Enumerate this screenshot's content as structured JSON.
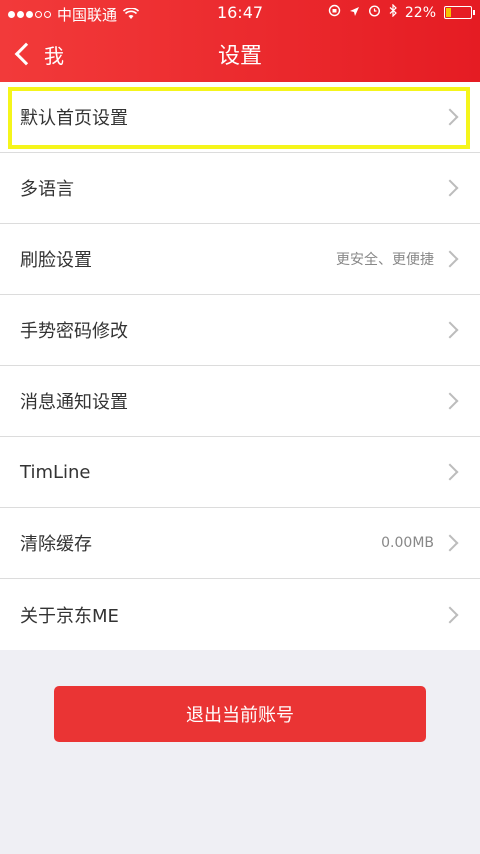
{
  "status_bar": {
    "carrier": "中国联通",
    "time": "16:47",
    "battery": "22%",
    "battery_level": 0.22
  },
  "nav": {
    "back_label": "我",
    "title": "设置"
  },
  "rows": [
    {
      "label": "默认首页设置",
      "value": ""
    },
    {
      "label": "多语言",
      "value": ""
    },
    {
      "label": "刷脸设置",
      "value": "更安全、更便捷"
    },
    {
      "label": "手势密码修改",
      "value": ""
    },
    {
      "label": "消息通知设置",
      "value": ""
    },
    {
      "label": "TimLine",
      "value": ""
    },
    {
      "label": "清除缓存",
      "value": "0.00MB"
    },
    {
      "label": "关于京东ME",
      "value": ""
    }
  ],
  "logout_label": "退出当前账号",
  "colors": {
    "header": "#e51c23",
    "button": "#ea3434",
    "highlight": "#f5f51b",
    "background": "#efeff4"
  }
}
